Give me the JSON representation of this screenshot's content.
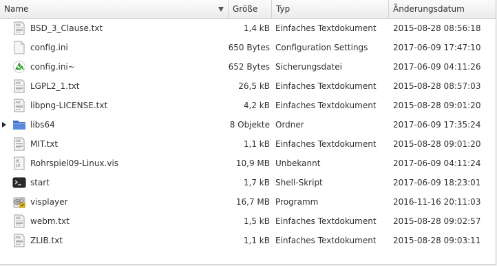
{
  "columns": {
    "name": "Name",
    "size": "Größe",
    "type": "Typ",
    "date": "Änderungsdatum"
  },
  "files": [
    {
      "name": "BSD_3_Clause.txt",
      "size": "1,4 kB",
      "type": "Einfaches Textdokument",
      "date": "2015-08-28 08:56:18",
      "icon": "text-file-icon"
    },
    {
      "name": "config.ini",
      "size": "650 Bytes",
      "type": "Configuration Settings",
      "date": "2017-06-09 17:47:10",
      "icon": "blank-file-icon"
    },
    {
      "name": "config.ini~",
      "size": "652 Bytes",
      "type": "Sicherungsdatei",
      "date": "2017-06-09 04:11:26",
      "icon": "backup-file-icon"
    },
    {
      "name": "LGPL2_1.txt",
      "size": "26,5 kB",
      "type": "Einfaches Textdokument",
      "date": "2015-08-28 08:57:03",
      "icon": "text-file-icon"
    },
    {
      "name": "libpng-LICENSE.txt",
      "size": "4,2 kB",
      "type": "Einfaches Textdokument",
      "date": "2015-08-28 09:01:20",
      "icon": "text-file-icon"
    },
    {
      "name": "libs64",
      "size": "8 Objekte",
      "type": "Ordner",
      "date": "2017-06-09 17:35:24",
      "icon": "folder-icon",
      "expandable": true
    },
    {
      "name": "MIT.txt",
      "size": "1,1 kB",
      "type": "Einfaches Textdokument",
      "date": "2015-08-28 09:01:20",
      "icon": "text-file-icon"
    },
    {
      "name": "Rohrspiel09-Linux.vis",
      "size": "10,9 MB",
      "type": "Unbekannt",
      "date": "2017-06-09 04:11:24",
      "icon": "binary-file-icon"
    },
    {
      "name": "start",
      "size": "1,7 kB",
      "type": "Shell-Skript",
      "date": "2017-06-09 18:23:01",
      "icon": "terminal-icon"
    },
    {
      "name": "visplayer",
      "size": "16,7 MB",
      "type": "Programm",
      "date": "2016-11-16 20:11:03",
      "icon": "executable-icon"
    },
    {
      "name": "webm.txt",
      "size": "1,5 kB",
      "type": "Einfaches Textdokument",
      "date": "2015-08-28 09:02:57",
      "icon": "text-file-icon"
    },
    {
      "name": "ZLIB.txt",
      "size": "1,1 kB",
      "type": "Einfaches Textdokument",
      "date": "2015-08-28 09:03:11",
      "icon": "text-file-icon"
    }
  ],
  "colors": {
    "header_bg": "#ececec",
    "row_bg": "#ffffff",
    "folder_blue": "#4a77c9",
    "backup_green": "#3aa63a"
  }
}
